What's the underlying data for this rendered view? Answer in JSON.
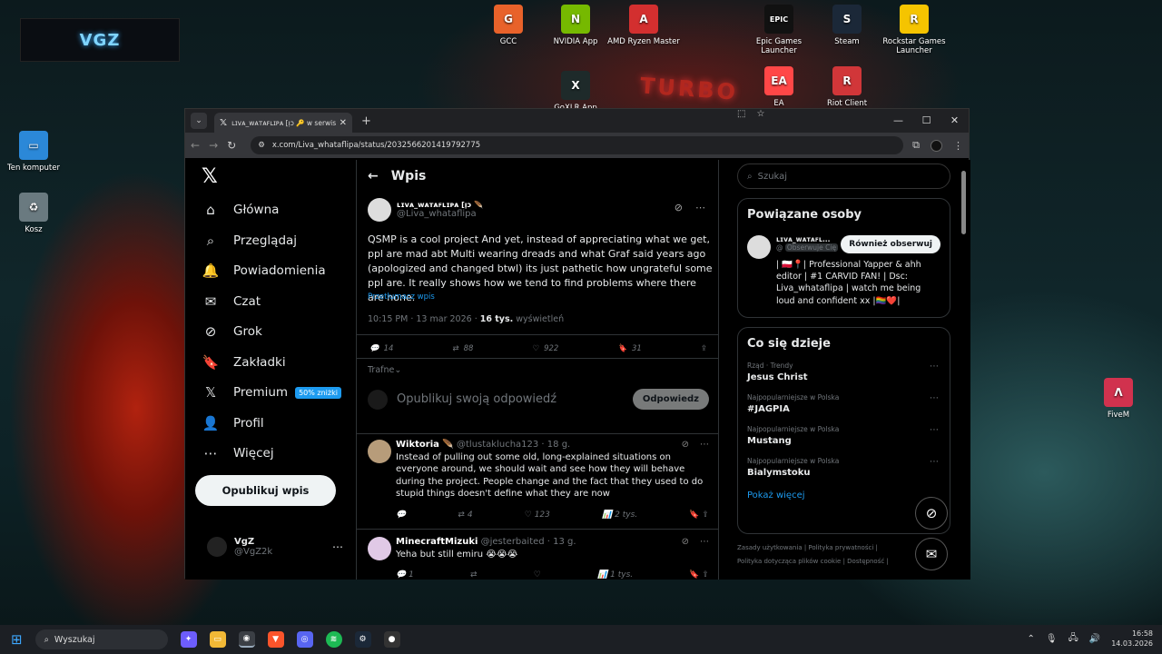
{
  "desktop": {
    "logo": "VGZ",
    "icons_top": [
      {
        "label": "GCC",
        "color": "#e8622a",
        "glyph": "G"
      },
      {
        "label": "NVIDIA App",
        "color": "#76b900",
        "glyph": "N"
      },
      {
        "label": "AMD Ryzen Master",
        "color": "#d32f2f",
        "glyph": "A"
      },
      {
        "label": "Epic Games Launcher",
        "color": "#111111",
        "glyph": "EPIC"
      },
      {
        "label": "Steam",
        "color": "#1b2838",
        "glyph": "S"
      },
      {
        "label": "Rockstar Games Launcher",
        "color": "#f5c400",
        "glyph": "R"
      },
      {
        "label": "GoXLR App",
        "color": "#1e2a2a",
        "glyph": "X"
      },
      {
        "label": "EA",
        "color": "#ff4747",
        "glyph": "EA"
      },
      {
        "label": "Riot Client",
        "color": "#d13639",
        "glyph": "R"
      }
    ],
    "icons_left": [
      {
        "label": "Ten komputer",
        "color": "#2b88d8",
        "glyph": "▭"
      },
      {
        "label": "Kosz",
        "color": "#6a7a80",
        "glyph": "♻"
      }
    ],
    "icon_right": {
      "label": "FiveM",
      "color": "#d1324e",
      "glyph": "Λ"
    },
    "sign": "TURBO"
  },
  "browser": {
    "tab_title": "ʟɪᴠᴀ_ᴡᴀᴛᴀꜰʟɪᴘᴀ [ᴉɔ 🔑 w serwisie X",
    "url": "x.com/Liva_whataflipa/status/2032566201419792775"
  },
  "nav": {
    "items": [
      "Główna",
      "Przeglądaj",
      "Powiadomienia",
      "Czat",
      "Grok",
      "Zakładki",
      "Premium",
      "Profil",
      "Więcej"
    ],
    "premium_badge": "50% zniżki",
    "post_button": "Opublikuj wpis",
    "me_name": "VgZ",
    "me_handle": "@VgZ2k"
  },
  "post": {
    "header": "Wpis",
    "author_name": "ʟɪᴠᴀ_ᴡᴀᴛᴀꜰʟɪᴘᴀ [ᴉɔ 🪶",
    "author_handle": "@Liva_whataflipa",
    "text": "QSMP is a cool project And yet, instead of appreciating what we get, ppl are mad abt Multi wearing dreads and what Graf said years ago (apologized and changed btwl) its just pathetic how ungrateful some ppl are. It really shows how we tend to find problems where there are none.",
    "translate": "Przetłumacz wpis",
    "time": "10:15 PM · 13 mar 2026 · ",
    "views_count": "16 tys.",
    "views_label": " wyświetleń",
    "replies": "14",
    "reposts": "88",
    "likes": "922",
    "bookmarks": "31",
    "sort": "Trafne",
    "reply_placeholder": "Opublikuj swoją odpowiedź",
    "reply_button": "Odpowiedz"
  },
  "replies": [
    {
      "name": "Wiktoria 🪶",
      "handle": "@tlustaklucha123 · 18 g.",
      "text": "Instead of pulling out some old, long-explained situations on everyone around, we should wait and see how they will behave during the project. People change and the fact that they used to do stupid things doesn't define what they are now",
      "replies": "",
      "reposts": "4",
      "likes": "123",
      "views": "2 tys."
    },
    {
      "name": "MinecraftMizuki",
      "handle": "@jesterbaited · 13 g.",
      "text": "Yeha but still emiru 😭😭😭",
      "replies": "1",
      "reposts": "",
      "likes": "",
      "views": "1 tys."
    }
  ],
  "sidebar": {
    "search_placeholder": "Szukaj",
    "related_title": "Powiązane osoby",
    "rel_name": "ʟɪᴠᴀ_ᴡᴀᴛᴀꜰʟ...",
    "rel_handle": "@",
    "rel_follows": "Obserwuje Cię",
    "follow_button": "Również obserwuj",
    "bio": "| 🇵🇱📍| Professional Yapper & ahh editor | #1 CARVID FAN! | Dsc: Liva_whataflipa | watch me being loud and confident xx |🏳️‍🌈❤️|",
    "trends_title": "Co się dzieje",
    "trends": [
      {
        "context": "Rząd · Trendy",
        "name": "Jesus Christ"
      },
      {
        "context": "Najpopularniejsze w Polska",
        "name": "#JAGPIA"
      },
      {
        "context": "Najpopularniejsze w Polska",
        "name": "Mustang"
      },
      {
        "context": "Najpopularniejsze w Polska",
        "name": "Bialymstoku"
      }
    ],
    "show_more": "Pokaż więcej",
    "footer1": "Zasady użytkowania  |  Polityka prywatności  |",
    "footer2": "Polityka dotycząca plików cookie  |  Dostępność  |"
  },
  "taskbar": {
    "search": "Wyszukaj",
    "time": "16:58",
    "date": "14.03.2026"
  }
}
